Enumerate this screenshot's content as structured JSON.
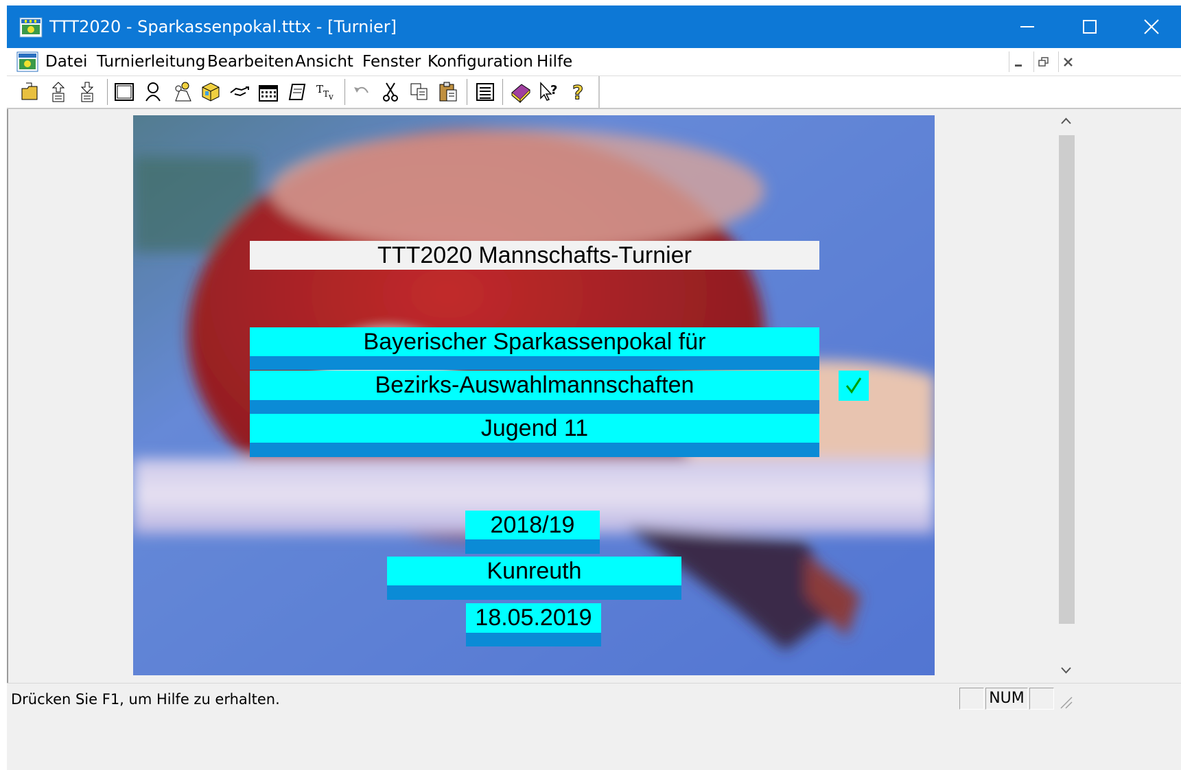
{
  "window": {
    "title": "TTT2020 - Sparkassenpokal.tttx - [Turnier]"
  },
  "menu": {
    "items": [
      {
        "label": "Datei"
      },
      {
        "label": "Turnierleitung"
      },
      {
        "label": "Bearbeiten"
      },
      {
        "label": "Ansicht"
      },
      {
        "label": "Fenster"
      },
      {
        "label": "Konfiguration"
      },
      {
        "label": "Hilfe"
      }
    ]
  },
  "toolbar": {
    "buttons": [
      "open-icon",
      "import-icon",
      "export-icon",
      "window-icon",
      "players-icon",
      "team-icon",
      "cube-icon",
      "handshake-icon",
      "calendar-icon",
      "print-icon",
      "font-icon",
      "undo-icon",
      "cut-icon",
      "copy-icon",
      "paste-icon",
      "list-icon",
      "book-icon",
      "context-help-icon",
      "help-icon"
    ]
  },
  "tournament": {
    "heading": "TTT2020 Mannschafts-Turnier",
    "name_line1": "Bayerischer Sparkassenpokal für",
    "name_line2": "Bezirks-Auswahlmannschaften",
    "name_line3": "Jugend 11",
    "season": "2018/19",
    "location": "Kunreuth",
    "date": "18.05.2019",
    "checked": true
  },
  "status": {
    "message": "Drücken Sie F1, um Hilfe zu erhalten.",
    "num_indicator": "NUM"
  },
  "colors": {
    "titlebar": "#0d78d6",
    "field_face": "#00ffff",
    "field_band": "#0b8bd6",
    "check": "#00a000"
  }
}
